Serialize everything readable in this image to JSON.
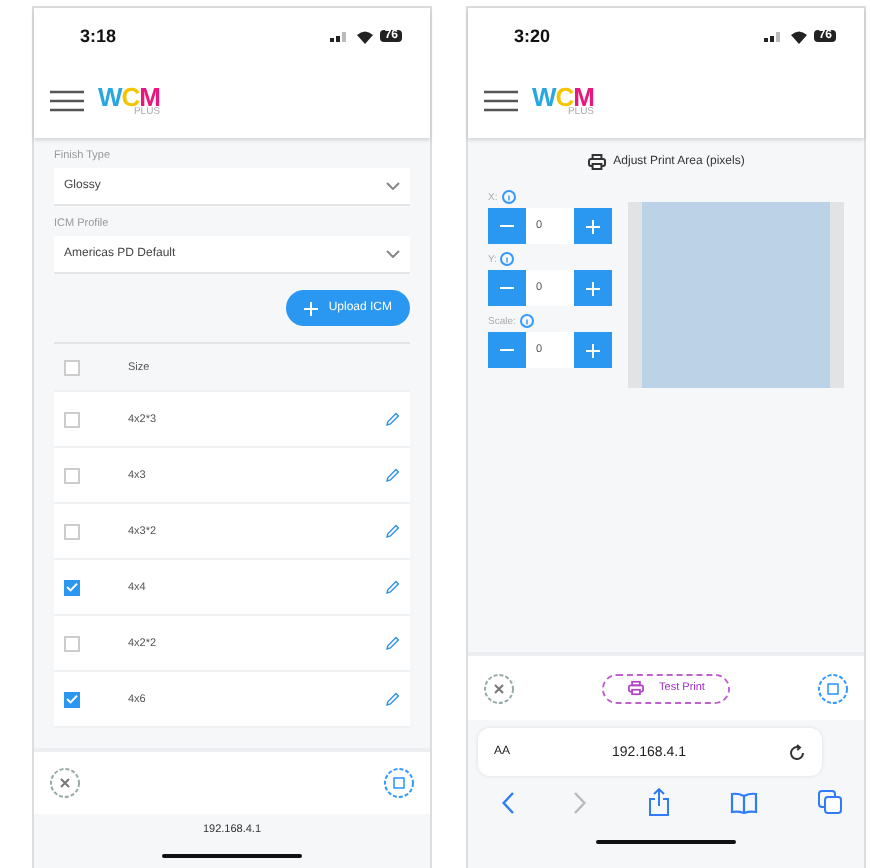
{
  "left_screen": {
    "status": {
      "time": "3:18",
      "battery": "76"
    },
    "logo": {
      "letters": [
        {
          "char": "W",
          "color": "#29a8e0"
        },
        {
          "char": "C",
          "color": "#f5c400"
        },
        {
          "char": "M",
          "color": "#e6177f"
        }
      ],
      "sub": "PLUS"
    },
    "fields": [
      {
        "label": "Finish Type",
        "value": "Glossy"
      },
      {
        "label": "ICM Profile",
        "value": "Americas PD Default"
      }
    ],
    "upload_button": "Upload ICM",
    "table": {
      "header": "Size",
      "header_checked": false,
      "rows": [
        {
          "size": "4x2*3",
          "checked": false
        },
        {
          "size": "4x3",
          "checked": false
        },
        {
          "size": "4x3*2",
          "checked": false
        },
        {
          "size": "4x4",
          "checked": true
        },
        {
          "size": "4x2*2",
          "checked": false
        },
        {
          "size": "4x6",
          "checked": true
        }
      ]
    },
    "url": "192.168.4.1"
  },
  "right_screen": {
    "status": {
      "time": "3:20",
      "battery": "76"
    },
    "logo": {
      "letters": [
        {
          "char": "W",
          "color": "#29a8e0"
        },
        {
          "char": "C",
          "color": "#f5c400"
        },
        {
          "char": "M",
          "color": "#e6177f"
        }
      ],
      "sub": "PLUS"
    },
    "title": "Adjust Print Area (pixels)",
    "steppers": [
      {
        "label": "X:",
        "value": "0"
      },
      {
        "label": "Y:",
        "value": "0"
      },
      {
        "label": "Scale:",
        "value": "0"
      }
    ],
    "test_print_button": "Test Print",
    "browser": {
      "text_size": "AA",
      "url": "192.168.4.1"
    }
  }
}
